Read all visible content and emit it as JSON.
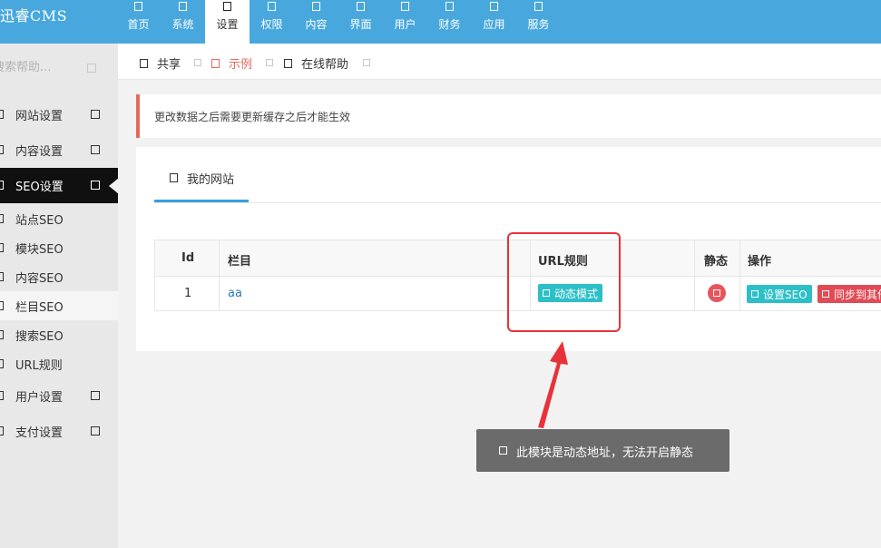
{
  "app": {
    "title": "迅睿CMS"
  },
  "nav": {
    "items": [
      {
        "label": "首页"
      },
      {
        "label": "系统"
      },
      {
        "label": "设置"
      },
      {
        "label": "权限"
      },
      {
        "label": "内容"
      },
      {
        "label": "界面"
      },
      {
        "label": "用户"
      },
      {
        "label": "财务"
      },
      {
        "label": "应用"
      },
      {
        "label": "服务"
      }
    ],
    "active": "设置"
  },
  "sidebar": {
    "search_placeholder": "搜索帮助...",
    "items": [
      {
        "label": "网站设置"
      },
      {
        "label": "内容设置"
      },
      {
        "label": "SEO设置"
      },
      {
        "label": "站点SEO"
      },
      {
        "label": "模块SEO"
      },
      {
        "label": "内容SEO"
      },
      {
        "label": "栏目SEO"
      },
      {
        "label": "搜索SEO"
      },
      {
        "label": "URL规则"
      },
      {
        "label": "用户设置"
      },
      {
        "label": "支付设置"
      }
    ],
    "active": "SEO设置",
    "selected_sub": "栏目SEO"
  },
  "tabs": {
    "items": [
      {
        "label": "共享"
      },
      {
        "label": "示例"
      },
      {
        "label": "在线帮助"
      }
    ],
    "active": "示例"
  },
  "notice": {
    "text": "更改数据之后需要更新缓存之后才能生效"
  },
  "card": {
    "tab_label": "我的网站"
  },
  "table": {
    "headers": {
      "id": "Id",
      "column": "栏目",
      "url_rule": "URL规则",
      "static": "静态",
      "actions": "操作"
    },
    "rows": [
      {
        "id": "1",
        "column": "aa",
        "url_rule": "动态模式",
        "action_seo": "设置SEO",
        "action_sync": "同步到其他"
      }
    ]
  },
  "tooltip": {
    "text": "此模块是动态地址，无法开启静态"
  },
  "colors": {
    "topbar": "#48a8dd",
    "accent_red": "#e7695b",
    "tag_cyan": "#2dbfc7",
    "tag_red": "#e24b55",
    "highlight": "#e8323a"
  }
}
